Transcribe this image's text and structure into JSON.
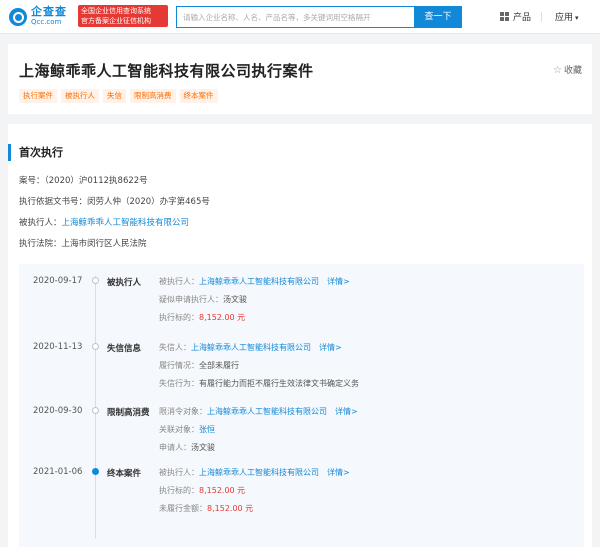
{
  "topbar": {
    "logo_cn": "企查查",
    "logo_en": "Qcc.com",
    "badge_line1": "全国企业信用查询系统",
    "badge_line2": "官方备案企业征信机构",
    "search_placeholder": "请输入企业名称、人名、产品名等，多关键词用空格隔开",
    "search_button": "查一下",
    "nav_products": "产品",
    "nav_apps": "应用",
    "nav_apps_caret": "▾"
  },
  "header": {
    "title": "上海鲸乖乖人工智能科技有限公司执行案件",
    "favorite": "收藏",
    "tags": [
      "执行案件",
      "被执行人",
      "失信",
      "限制高消费",
      "终本案件"
    ]
  },
  "section": {
    "title": "首次执行",
    "case_no_label": "案号：",
    "case_no": "（2020）沪0112执8622号",
    "basis_label": "执行依据文书号：",
    "basis": "闵劳人仲（2020）办字第465号",
    "debtor_label": "被执行人：",
    "debtor": "上海鲸乖乖人工智能科技有限公司",
    "court_label": "执行法院：",
    "court": "上海市闵行区人民法院"
  },
  "timeline": [
    {
      "date": "2020-09-17",
      "category": "被执行人",
      "active": false,
      "rows": [
        {
          "label": "被执行人：",
          "value": "上海鲸乖乖人工智能科技有限公司",
          "type": "co",
          "detail": "详情>"
        },
        {
          "label": "疑似申请执行人：",
          "value": "汤文骏",
          "type": "val"
        },
        {
          "label": "执行标的：",
          "value": "8,152.00 元",
          "type": "amt"
        }
      ]
    },
    {
      "date": "2020-11-13",
      "category": "失信信息",
      "active": false,
      "rows": [
        {
          "label": "失信人：",
          "value": "上海鲸乖乖人工智能科技有限公司",
          "type": "co",
          "detail": "详情>"
        },
        {
          "label": "履行情况：",
          "value": "全部未履行",
          "type": "val"
        },
        {
          "label": "失信行为：",
          "value": "有履行能力而拒不履行生效法律文书确定义务",
          "type": "val"
        }
      ]
    },
    {
      "date": "2020-09-30",
      "category": "限制高消费",
      "active": false,
      "rows": [
        {
          "label": "限消令对象：",
          "value": "上海鲸乖乖人工智能科技有限公司",
          "type": "co",
          "detail": "详情>"
        },
        {
          "label": "关联对象：",
          "value": "张恒",
          "type": "co"
        },
        {
          "label": "申请人：",
          "value": "汤文骏",
          "type": "val"
        }
      ]
    },
    {
      "date": "2021-01-06",
      "category": "终本案件",
      "active": true,
      "rows": [
        {
          "label": "被执行人：",
          "value": "上海鲸乖乖人工智能科技有限公司",
          "type": "co",
          "detail": "详情>"
        },
        {
          "label": "执行标的：",
          "value": "8,152.00 元",
          "type": "amt"
        },
        {
          "label": "未履行金额：",
          "value": "8,152.00 元",
          "type": "amt"
        }
      ]
    }
  ]
}
